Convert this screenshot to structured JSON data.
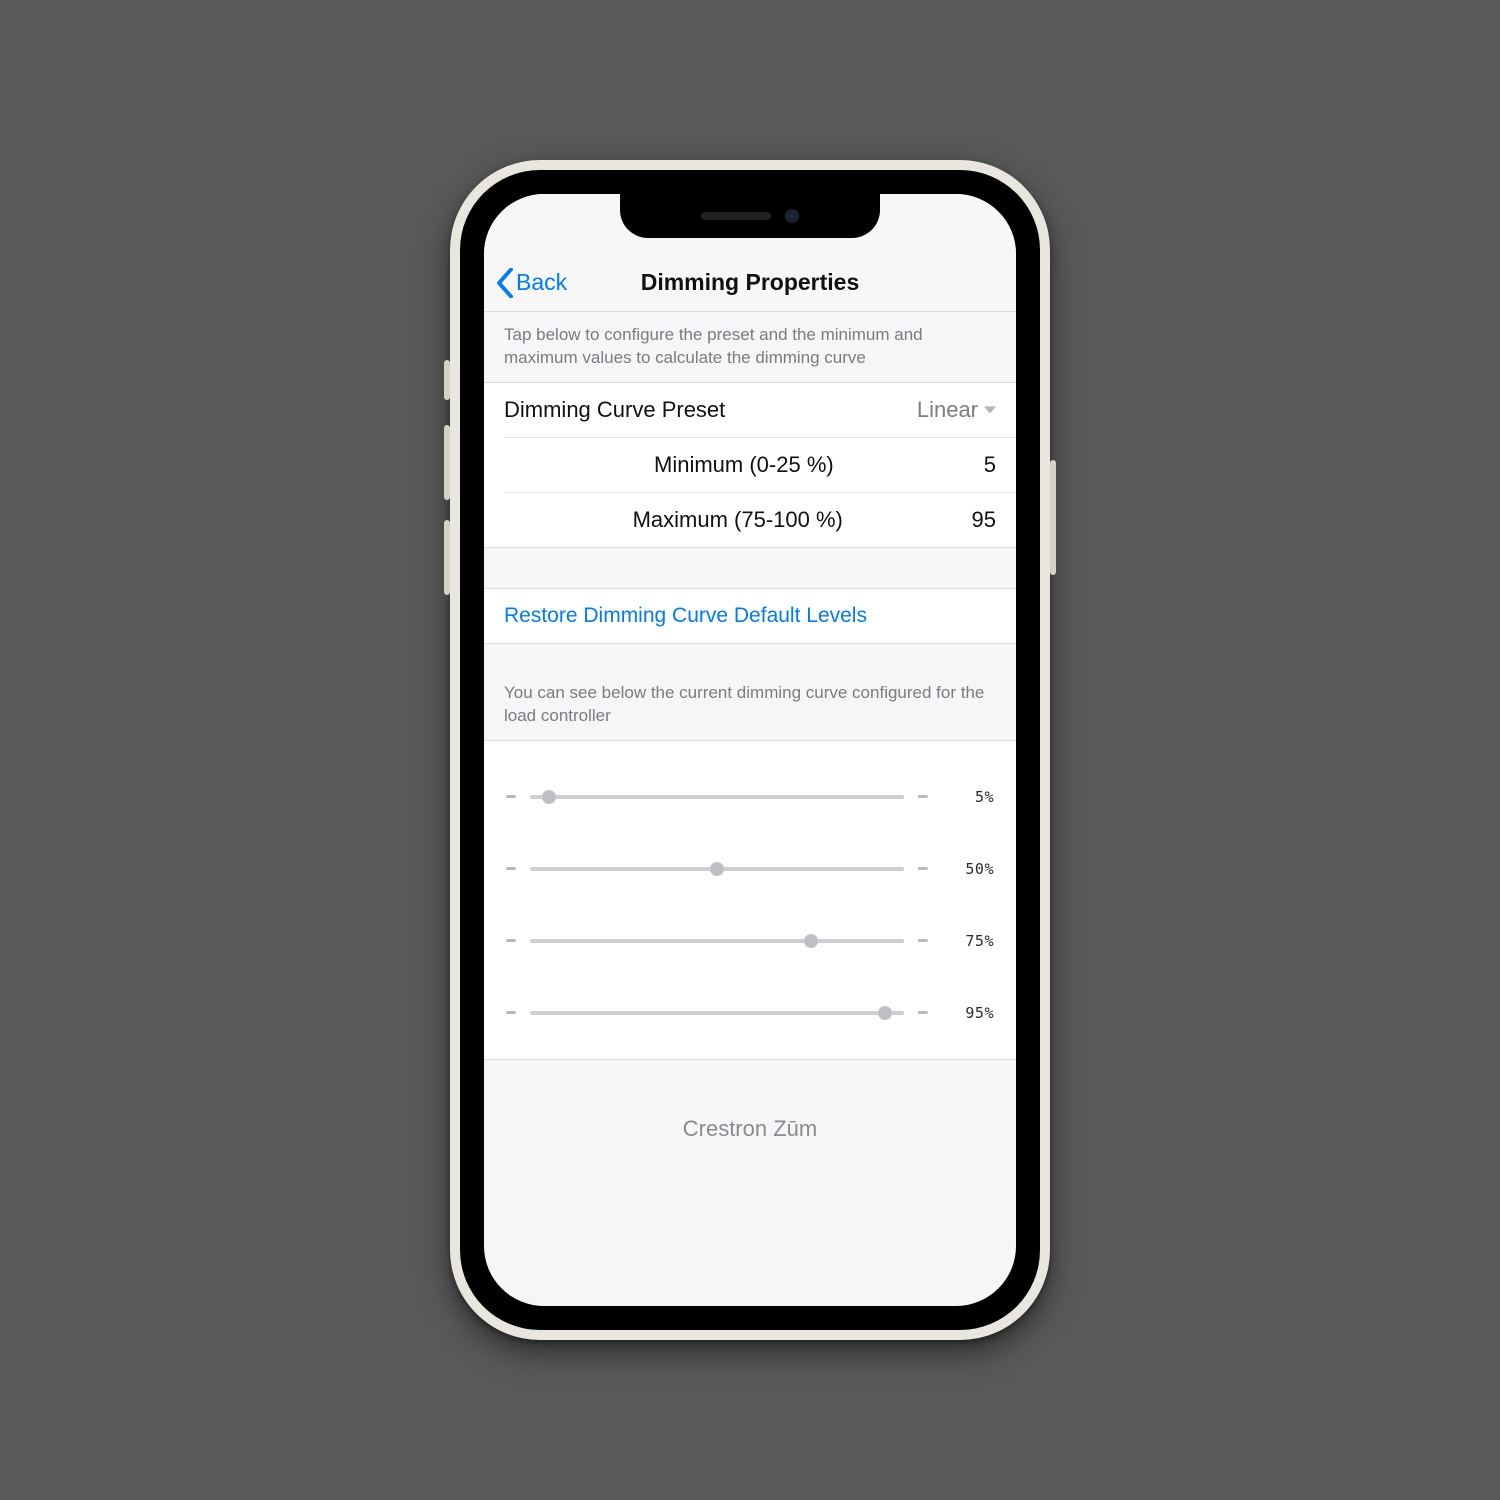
{
  "nav": {
    "back_label": "Back",
    "title": "Dimming Properties"
  },
  "hints": {
    "top": "Tap below to configure the preset and the minimum and maximum values to calculate the dimming curve",
    "bottom": "You can see below the current dimming curve configured for the load controller"
  },
  "rows": {
    "preset_label": "Dimming Curve Preset",
    "preset_value": "Linear",
    "min_label": "Minimum (0-25 %)",
    "min_value": "5",
    "max_label": "Maximum (75-100 %)",
    "max_value": "95"
  },
  "actions": {
    "restore_label": "Restore Dimming Curve Default Levels"
  },
  "sliders": [
    {
      "percent": 5,
      "label": "5%"
    },
    {
      "percent": 50,
      "label": "50%"
    },
    {
      "percent": 75,
      "label": "75%"
    },
    {
      "percent": 95,
      "label": "95%"
    }
  ],
  "footer": {
    "brand": "Crestron Zūm"
  },
  "colors": {
    "ios_blue": "#007aff"
  }
}
